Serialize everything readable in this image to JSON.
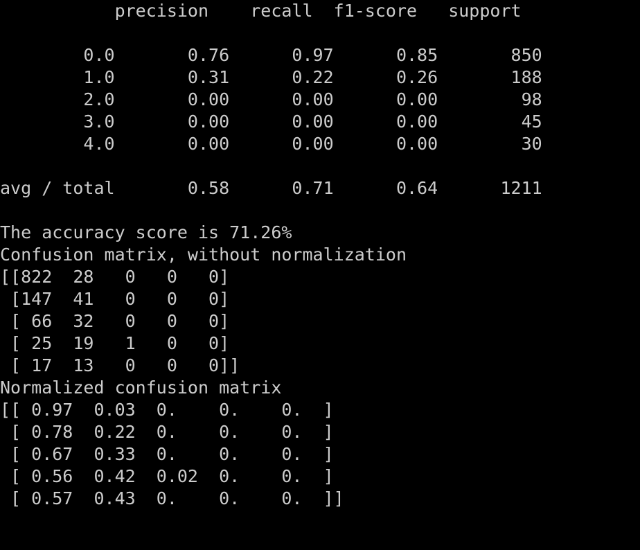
{
  "terminal": {
    "background": "#000000",
    "foreground": "#cccccc",
    "lines": [
      "           precision    recall  f1-score   support",
      "",
      "        0.0       0.76      0.97      0.85       850",
      "        1.0       0.31      0.22      0.26       188",
      "        2.0       0.00      0.00      0.00        98",
      "        3.0       0.00      0.00      0.00        45",
      "        4.0       0.00      0.00      0.00        30",
      "",
      "avg / total       0.58      0.71      0.64      1211",
      "",
      "The accuracy score is 71.26%",
      "Confusion matrix, without normalization",
      "[[822  28   0   0   0]",
      " [147  41   0   0   0]",
      " [ 66  32   0   0   0]",
      " [ 25  19   1   0   0]",
      " [ 17  13   0   0   0]]",
      "Normalized confusion matrix",
      "[[ 0.97  0.03  0.    0.    0.  ]",
      " [ 0.78  0.22  0.    0.    0.  ]",
      " [ 0.67  0.33  0.    0.    0.  ]",
      " [ 0.56  0.42  0.02  0.    0.  ]",
      " [ 0.57  0.43  0.    0.    0.  ]]"
    ]
  }
}
